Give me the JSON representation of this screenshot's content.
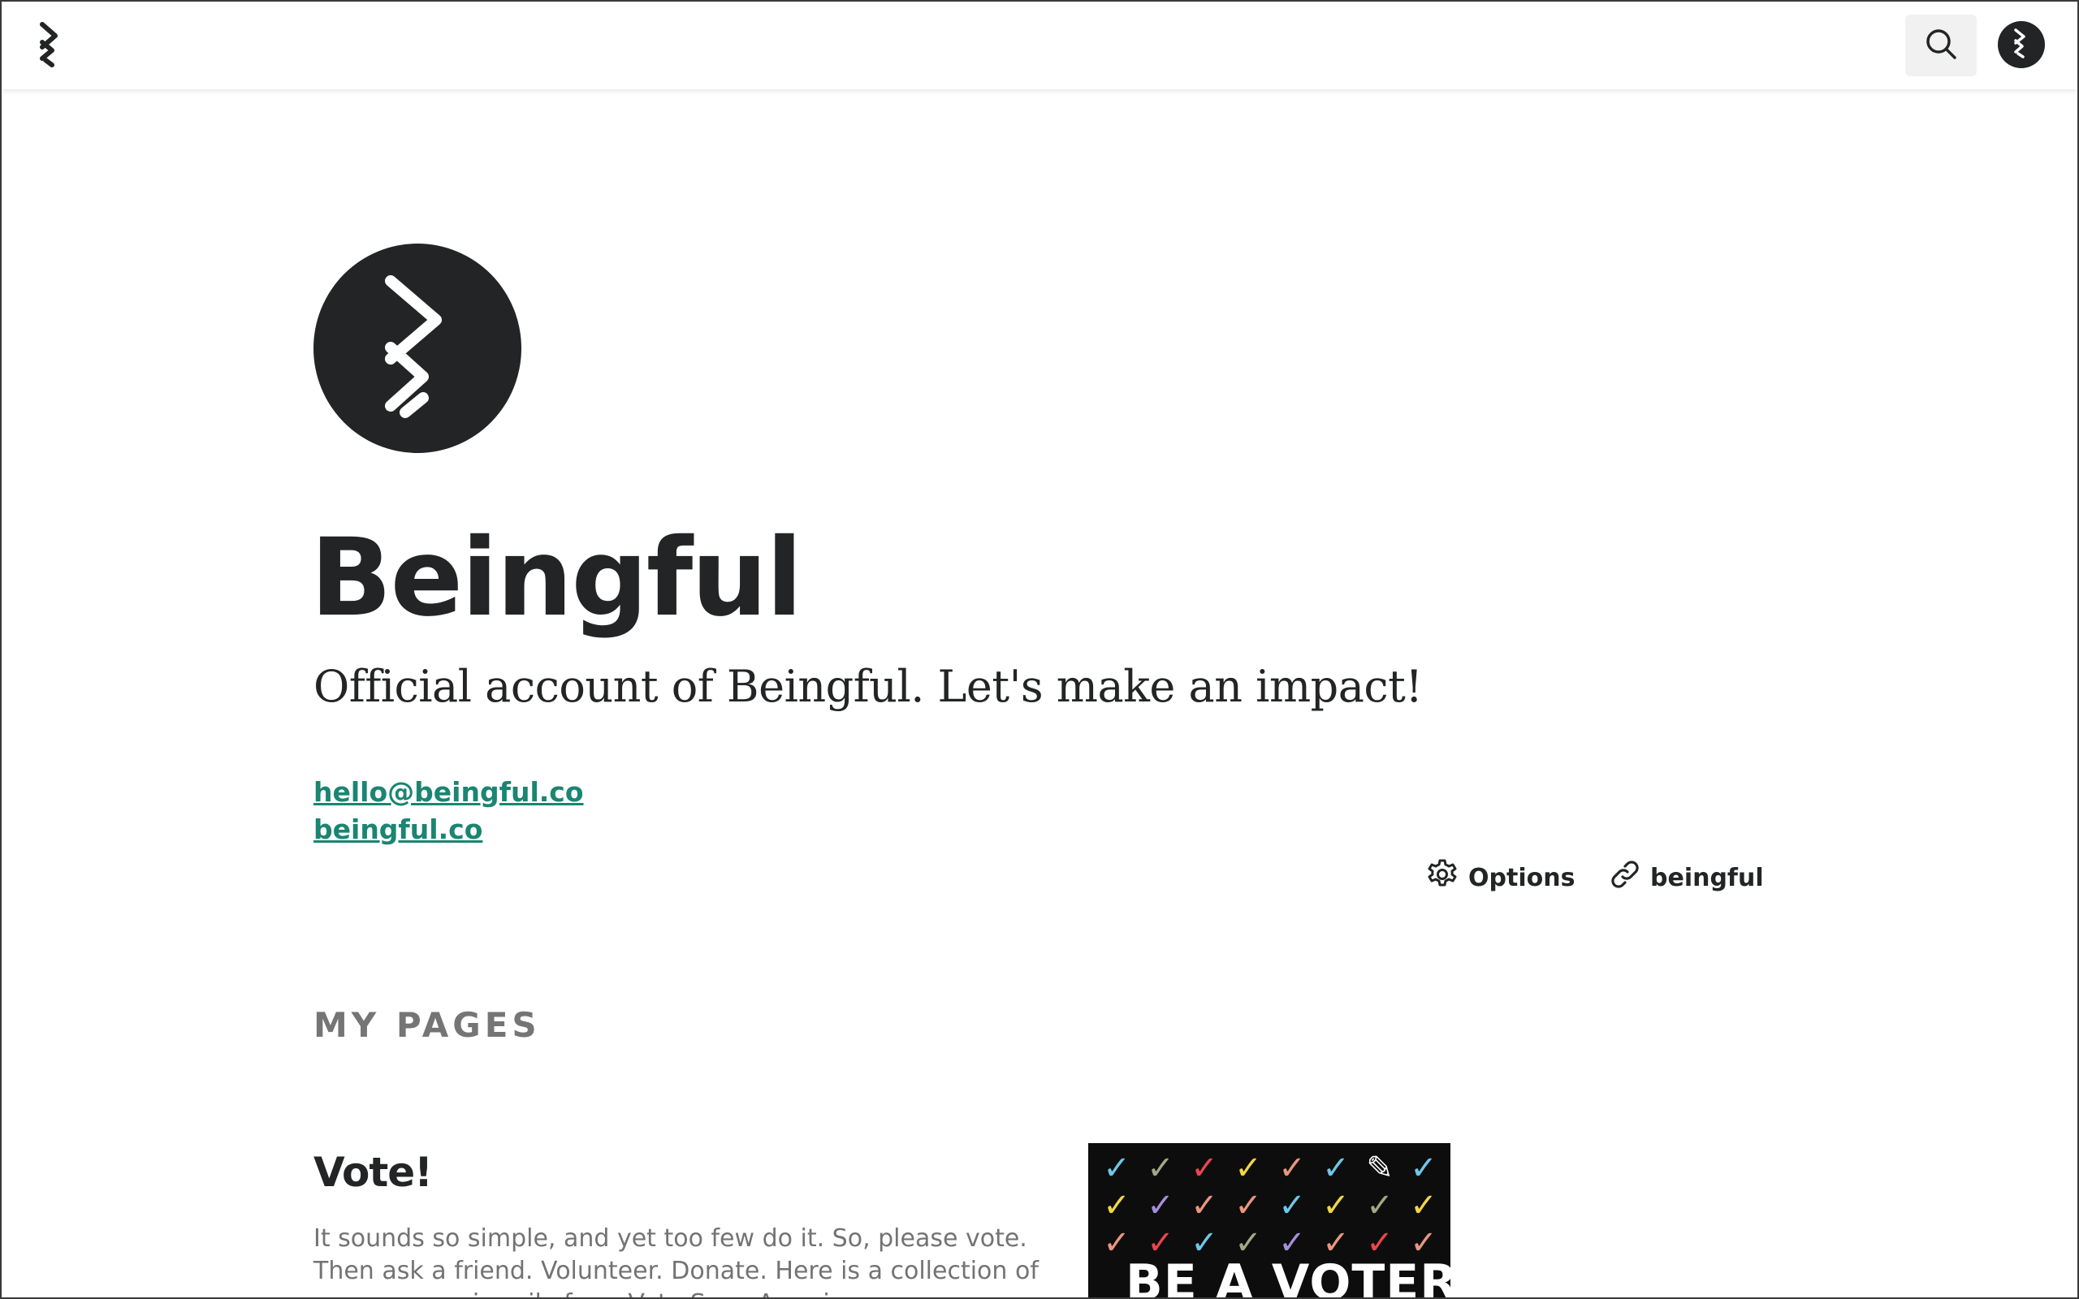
{
  "header": {
    "logo_icon": "beingful-logo-icon",
    "search_icon": "search-icon",
    "avatar_icon": "beingful-logo-icon"
  },
  "profile": {
    "name": "Beingful",
    "bio": "Official account of Beingful. Let's make an impact!",
    "email": "hello@beingful.co",
    "website": "beingful.co",
    "options_label": "Options",
    "share_label": "beingful"
  },
  "section": {
    "title": "MY PAGES"
  },
  "pages": [
    {
      "title": "Vote!",
      "description": "It sounds so simple, and yet too few do it. So, please vote. Then ask a friend. Volunteer. Donate. Here is a collection of resources, primarily from Vote Save America.",
      "image_text": "BE A VOTER,",
      "check_colors": [
        "#6ec6e8",
        "#a3a883",
        "#e8474a",
        "#f0d545",
        "#e8967e",
        "#6ec6e8",
        "#ffffff",
        "#6ec6e8",
        "#f0d545",
        "#a68fd8",
        "#e8967e",
        "#e8967e",
        "#6ec6e8",
        "#f0d545",
        "#a3a883",
        "#f0d545",
        "#e8967e",
        "#e8474a",
        "#6ec6e8",
        "#a3a883",
        "#a68fd8",
        "#e8967e",
        "#e8474a",
        "#e8967e"
      ]
    }
  ],
  "colors": {
    "link": "#1a8572",
    "text": "#222425",
    "muted": "#737373",
    "section": "#757575"
  }
}
